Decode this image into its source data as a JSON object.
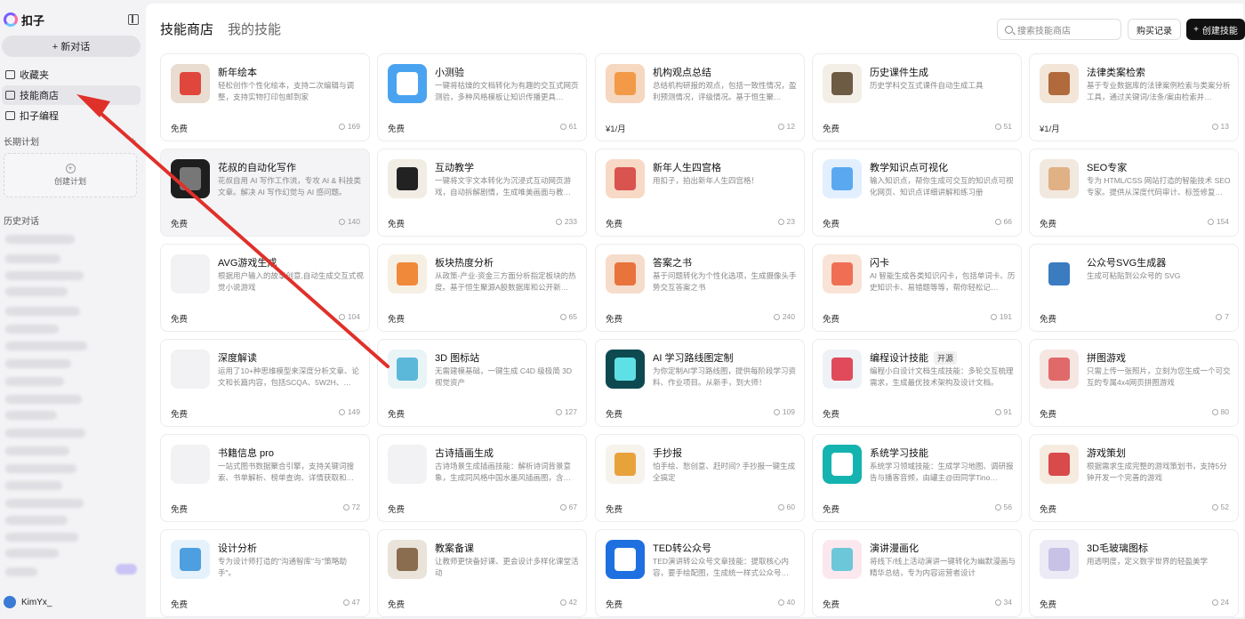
{
  "app": {
    "logo_text": "扣子"
  },
  "sidebar": {
    "new_chat": "+ 新对话",
    "items": [
      {
        "label": "收藏夹",
        "icon": "folder-icon"
      },
      {
        "label": "技能商店",
        "icon": "store-icon"
      },
      {
        "label": "扣子编程",
        "icon": "code-icon"
      }
    ],
    "long_plan_label": "长期计划",
    "create_plan": "创建计划",
    "history_label": "历史对话",
    "user_name": "KimYx_"
  },
  "header": {
    "tab_store": "技能商店",
    "tab_mine": "我的技能",
    "search_placeholder": "搜索技能商店",
    "purchase_label": "购买记录",
    "create_label": "创建技能"
  },
  "cards": [
    {
      "title": "新年绘本",
      "desc": "轻松创作个性化绘本，支持二次编辑与调整，支持实物打印包邮到家",
      "price": "免费",
      "users": "169",
      "thumb": "#e9dcd0",
      "accent": "#e0473c"
    },
    {
      "title": "小测验",
      "desc": "一键将枯燥的文档转化为有趣的交互式网页测验，多种风格模板让知识传播更具…",
      "price": "免费",
      "users": "61",
      "thumb": "#4aa3f0",
      "accent": "#ffffff"
    },
    {
      "title": "机构观点总结",
      "desc": "总结机构研报的观点，包括一致性情况，盈利预测情况，评级情况。基于恒生聚…",
      "price": "¥1/月",
      "users": "12",
      "thumb": "#f6d7bf",
      "accent": "#f29a48"
    },
    {
      "title": "历史课件生成",
      "desc": "历史学科交互式课件自动生成工具",
      "price": "免费",
      "users": "51",
      "thumb": "#f4efe6",
      "accent": "#6d5b44"
    },
    {
      "title": "法律类案检索",
      "desc": "基于专业数据库的法律案例检索与类案分析工具，通过关键词/法条/案由检索并…",
      "price": "¥1/月",
      "users": "13",
      "thumb": "#f3e6d8",
      "accent": "#b06a3b"
    },
    {
      "title": "花叔的自动化写作",
      "desc": "花叔自用 AI 写作工作流，专攻 AI & 科技类文章。解决 AI 写作幻觉与 AI 感问题。",
      "price": "免费",
      "users": "140",
      "thumb": "#1e1e1e",
      "accent": "#777777"
    },
    {
      "title": "互动教学",
      "desc": "一键将文字文本转化为沉浸式互动网页游戏，自动拆解剧情，生成唯美画面与教…",
      "price": "免费",
      "users": "233",
      "thumb": "#f2ede4",
      "accent": "#222222"
    },
    {
      "title": "新年人生四宫格",
      "desc": "用扣子，拍出新年人生四宫格！",
      "price": "免费",
      "users": "23",
      "thumb": "#f7d9c6",
      "accent": "#d9534f"
    },
    {
      "title": "教学知识点可视化",
      "desc": "输入知识点，帮你生成可交互的知识点可视化网页、知识点详细讲解和练习册",
      "price": "免费",
      "users": "66",
      "thumb": "#e2efff",
      "accent": "#5aa9f0"
    },
    {
      "title": "SEO专家",
      "desc": "专为 HTML/CSS 网站打造的智能技术 SEO 专家。提供从深度代码审计、标签修复…",
      "price": "免费",
      "users": "154",
      "thumb": "#f1e8df",
      "accent": "#e0b184"
    },
    {
      "title": "AVG游戏生成",
      "desc": "根据用户输入的故事创意,自动生成交互式视觉小说游戏",
      "price": "免费",
      "users": "104",
      "thumb": "#f2f2f4",
      "accent": "#f2f2f4"
    },
    {
      "title": "板块热度分析",
      "desc": "从政策-产业-资金三方面分析指定板块的热度。基于恒生聚源A股数据库和公开新…",
      "price": "免费",
      "users": "65",
      "thumb": "#f6efe4",
      "accent": "#f0893a"
    },
    {
      "title": "答案之书",
      "desc": "基于问题转化为个性化选项，生成摄像头手势交互答案之书",
      "price": "免费",
      "users": "240",
      "thumb": "#f6dccb",
      "accent": "#e8733b"
    },
    {
      "title": "闪卡",
      "desc": "AI 智能生成各类知识闪卡，包括单词卡、历史知识卡、易错题等等，帮你轻松记…",
      "price": "免费",
      "users": "191",
      "thumb": "#f9e3d6",
      "accent": "#ef6f55"
    },
    {
      "title": "公众号SVG生成器",
      "desc": "生成可粘贴到公众号的 SVG",
      "price": "免费",
      "users": "7",
      "thumb": "#ffffff",
      "accent": "#3b7bbf"
    },
    {
      "title": "深度解读",
      "desc": "运用了10+种思维模型来深度分析文章、论文和长篇内容，包括SCQA、5W2H、…",
      "price": "免费",
      "users": "149",
      "thumb": "#f2f2f4",
      "accent": "#f2f2f4"
    },
    {
      "title": "3D 图标站",
      "desc": "无需建模基础，一键生成 C4D 级极简 3D 视觉资产",
      "price": "免费",
      "users": "127",
      "thumb": "#e9f4f7",
      "accent": "#5bb8d8"
    },
    {
      "title": "AI 学习路线图定制",
      "desc": "为你定制AI学习路线图，提供每阶段学习资料、作业项目。从新手，到大师！",
      "price": "免费",
      "users": "109",
      "thumb": "#0e4950",
      "accent": "#5fe0e6"
    },
    {
      "title": "编程设计技能",
      "tag": "开源",
      "desc": "编程小白设计文档生成技能：多轮交互梳理需求，生成最优技术架构及设计文档。",
      "price": "免费",
      "users": "91",
      "thumb": "#eef2f7",
      "accent": "#e04a5a"
    },
    {
      "title": "拼图游戏",
      "desc": "只需上传一张照片，立刻为您生成一个可交互的专属4x4网页拼图游戏",
      "price": "免费",
      "users": "80",
      "thumb": "#f6e6e2",
      "accent": "#e06a6a"
    },
    {
      "title": "书籍信息 pro",
      "desc": "一站式图书数据聚合引擎，支持关键词搜索、书单解析、榜单查询、详情获取和…",
      "price": "免费",
      "users": "72",
      "thumb": "#f2f2f4",
      "accent": "#f2f2f4"
    },
    {
      "title": "古诗插画生成",
      "desc": "古诗场景生成插画技能：解析诗词背景意象，生成同风格中国水墨风插画图，含…",
      "price": "免费",
      "users": "67",
      "thumb": "#f2f2f4",
      "accent": "#f2f2f4"
    },
    {
      "title": "手抄报",
      "desc": "怕手绘、愁创意、赶时间? 手抄报一键生成全搞定",
      "price": "免费",
      "users": "60",
      "thumb": "#f6f2ec",
      "accent": "#e8a23a"
    },
    {
      "title": "系统学习技能",
      "desc": "系统学习领域技能：生成学习地图、调研报告与播客音频，由罐主@田同学Tino…",
      "price": "免费",
      "users": "56",
      "thumb": "#14b3b0",
      "accent": "#ffffff"
    },
    {
      "title": "游戏策划",
      "desc": "根据需求生成完整的游戏策划书，支持5分钟开发一个完善的游戏",
      "price": "免费",
      "users": "52",
      "thumb": "#f5ebdf",
      "accent": "#d94a4a"
    },
    {
      "title": "设计分析",
      "desc": "专为设计师打造的\"沟通智库\"与\"策略助手\"。",
      "price": "免费",
      "users": "47",
      "thumb": "#e6f2fb",
      "accent": "#4d9fe0"
    },
    {
      "title": "教案备课",
      "desc": "让教师更快备好课、更会设计多样化课堂活动",
      "price": "免费",
      "users": "42",
      "thumb": "#e9e3da",
      "accent": "#8a6c4f"
    },
    {
      "title": "TED转公众号",
      "desc": "TED演讲转公众号文章技能：提取核心内容，要手绘配图，生成统一样式公众号…",
      "price": "免费",
      "users": "40",
      "thumb": "#1e6fe0",
      "accent": "#ffffff"
    },
    {
      "title": "演讲漫画化",
      "desc": "将线下/线上活动演讲一键转化为幽默漫画与精华总结，专为内容运营者设计",
      "price": "免费",
      "users": "34",
      "thumb": "#fbe8ee",
      "accent": "#6cc7d8"
    },
    {
      "title": "3D毛玻璃图标",
      "desc": "用透明度，定义数字世界的轻盈美学",
      "price": "免费",
      "users": "24",
      "thumb": "#eceaf5",
      "accent": "#c7c2e6"
    }
  ]
}
